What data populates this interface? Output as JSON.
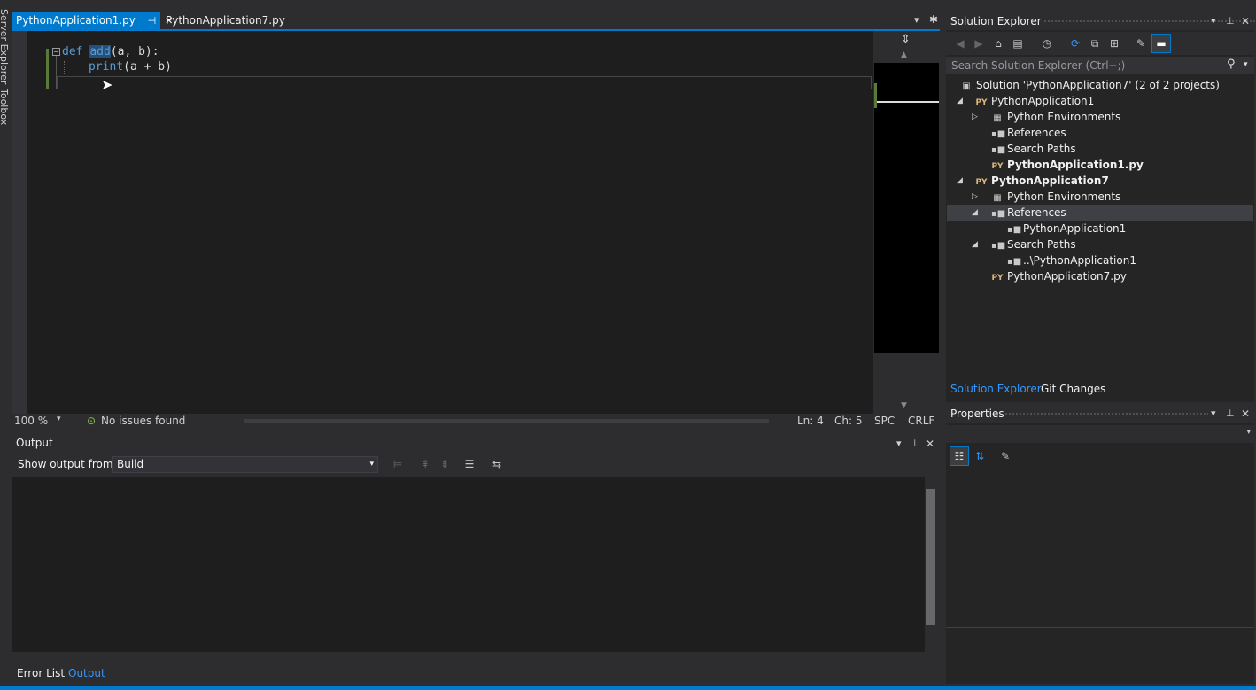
{
  "left_strip": {
    "labels": [
      "Server Explorer",
      "Toolbox"
    ]
  },
  "tabs": [
    {
      "label": "PythonApplication1.py",
      "active": true
    },
    {
      "label": "PythonApplication7.py",
      "active": false
    }
  ],
  "editor": {
    "code": {
      "line1_kw": "def",
      "line1_fn": "add",
      "line1_rest": "(a, b):",
      "line2_fn": "print",
      "line2_rest": "(a + b)"
    },
    "zoom": "100 %",
    "issues": "No issues found",
    "ln": "Ln: 4",
    "ch": "Ch: 5",
    "spc": "SPC",
    "crlf": "CRLF"
  },
  "output": {
    "title": "Output",
    "show_from_label": "Show output from:",
    "show_from_value": "Build"
  },
  "bottom_tabs": [
    "Error List",
    "Output"
  ],
  "solution_explorer": {
    "title": "Solution Explorer",
    "search_placeholder": "Search Solution Explorer (Ctrl+;)",
    "tree": [
      "Solution 'PythonApplication7' (2 of 2 projects)",
      "PythonApplication1",
      "Python Environments",
      "References",
      "Search Paths",
      "PythonApplication1.py",
      "PythonApplication7",
      "Python Environments",
      "References",
      "PythonApplication1",
      "Search Paths",
      "..\\PythonApplication1",
      "PythonApplication7.py"
    ],
    "py_badge": "PY",
    "tabs": [
      "Solution Explorer",
      "Git Changes"
    ]
  },
  "properties": {
    "title": "Properties"
  },
  "colors": {
    "accent": "#007acc",
    "editor_bg": "#1e1e1e",
    "keyword": "#569cd6"
  }
}
